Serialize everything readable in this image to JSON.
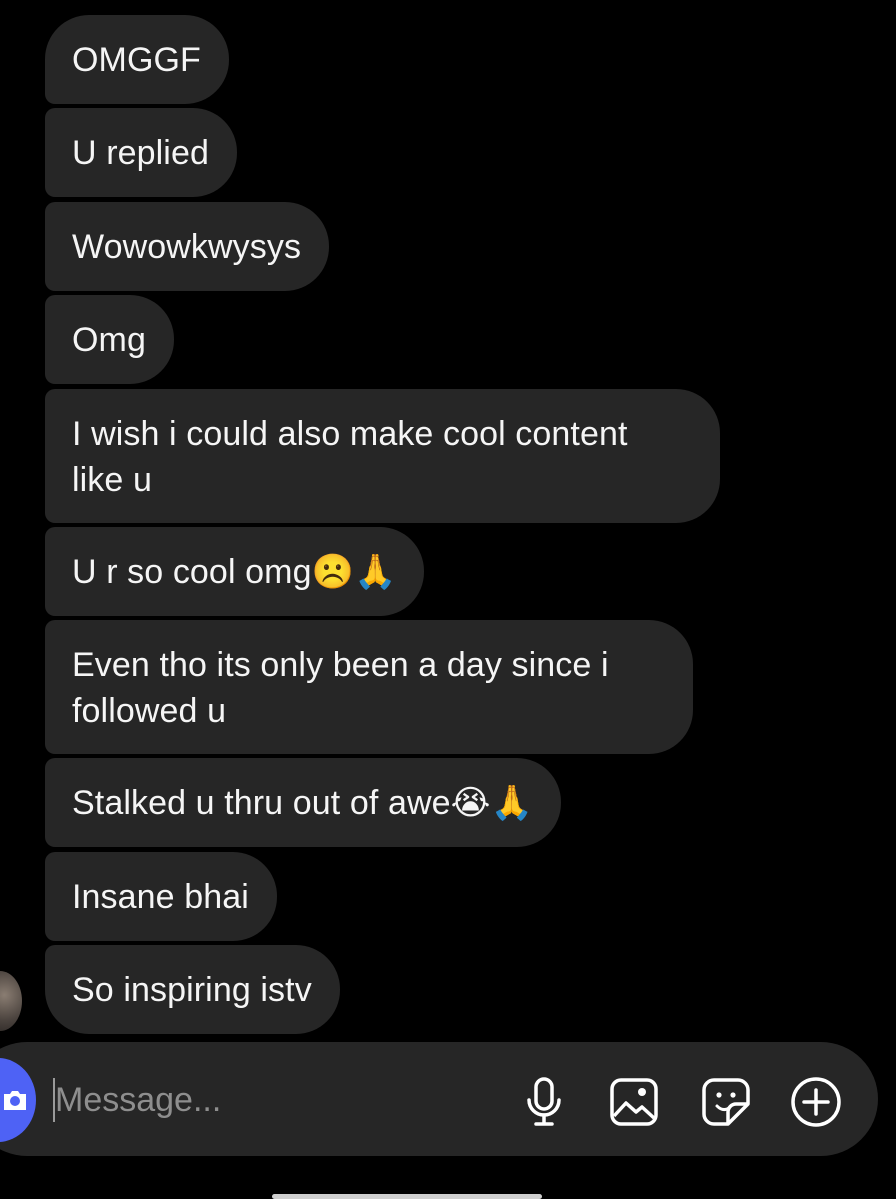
{
  "messages": [
    {
      "text": "OMGGF"
    },
    {
      "text": "U replied"
    },
    {
      "text": "Wowowkwysys"
    },
    {
      "text": "Omg"
    },
    {
      "text": "I wish i could also make cool content\nlike u"
    },
    {
      "text": "U r so cool omg☹️🙏"
    },
    {
      "text": "Even tho its only been a day since i\nfollowed u"
    },
    {
      "text": "Stalked u thru out of awe😭🙏"
    },
    {
      "text": "Insane bhai"
    },
    {
      "text": "So inspiring istv"
    }
  ],
  "composer": {
    "placeholder": "Message...",
    "icons": [
      "camera-icon",
      "microphone-icon",
      "gallery-icon",
      "sticker-icon",
      "plus-icon"
    ]
  },
  "colors": {
    "background": "#000000",
    "bubble": "#262626",
    "accent": "#4e62f5"
  }
}
